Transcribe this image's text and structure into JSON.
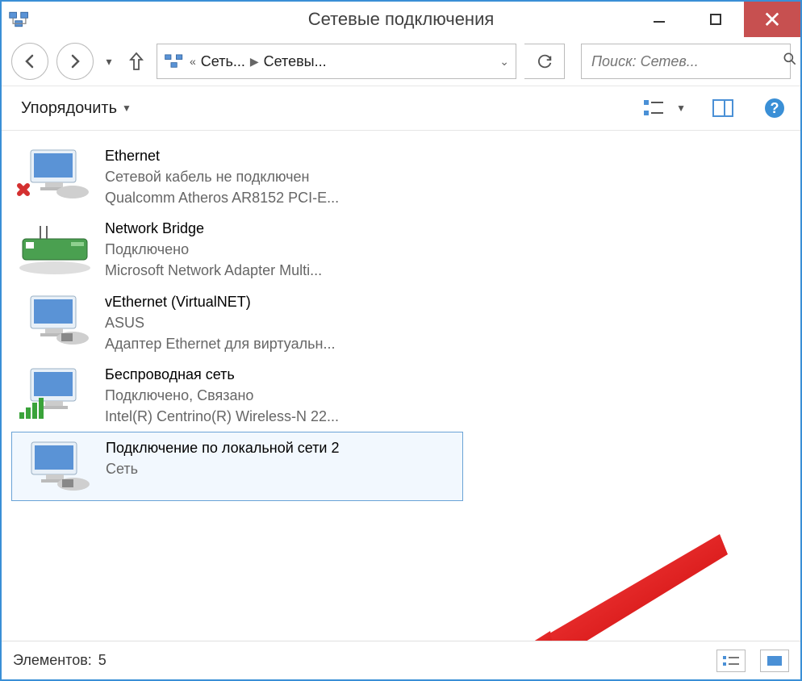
{
  "window": {
    "title": "Сетевые подключения"
  },
  "breadcrumb": {
    "prefix": "«",
    "crumb1": "Сеть...",
    "crumb2": "Сетевы..."
  },
  "search": {
    "placeholder": "Поиск: Сетев..."
  },
  "toolbar": {
    "organize_label": "Упорядочить"
  },
  "connections": [
    {
      "name": "Ethernet",
      "status": "Сетевой кабель не подключен",
      "device": "Qualcomm Atheros AR8152 PCI-E...",
      "icon_type": "disconnected"
    },
    {
      "name": "Network Bridge",
      "status": "Подключено",
      "device": "Microsoft Network Adapter Multi...",
      "icon_type": "bridge"
    },
    {
      "name": "vEthernet (VirtualNET)",
      "status": "ASUS",
      "device": "Адаптер Ethernet для виртуальн...",
      "icon_type": "ethernet"
    },
    {
      "name": "Беспроводная сеть",
      "status": "Подключено, Связано",
      "device": "Intel(R) Centrino(R) Wireless-N 22...",
      "icon_type": "wireless"
    },
    {
      "name": "Подключение по локальной сети 2",
      "status": "",
      "device": "Сеть",
      "icon_type": "lan",
      "selected": true
    }
  ],
  "statusbar": {
    "label": "Элементов:",
    "count": "5"
  }
}
